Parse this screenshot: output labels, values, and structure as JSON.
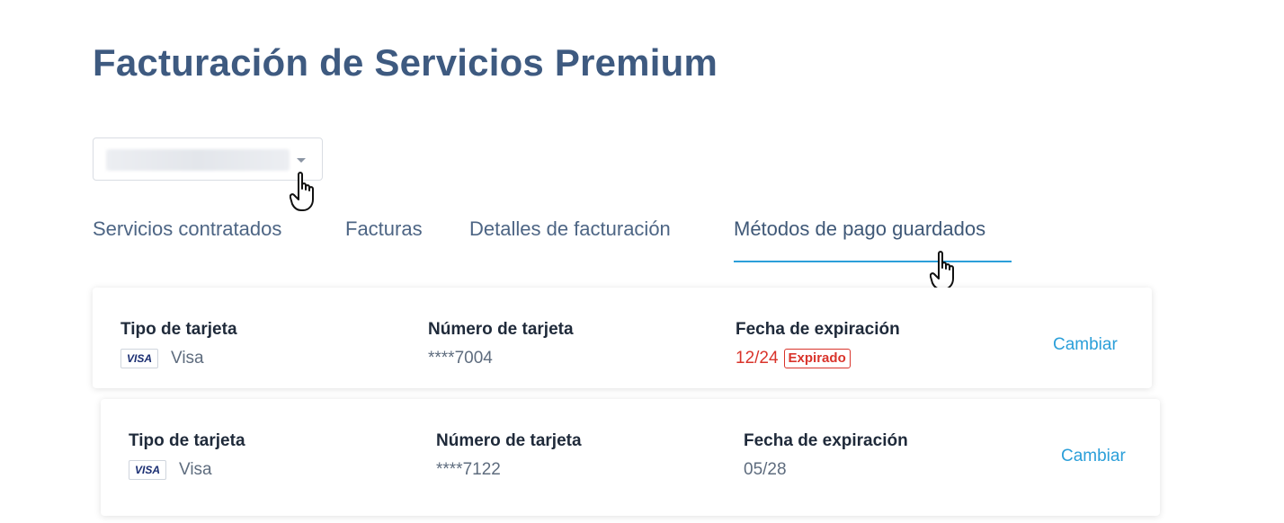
{
  "page": {
    "title": "Facturación de Servicios Premium"
  },
  "account_select": {
    "value": ""
  },
  "tabs": [
    {
      "label": "Servicios contratados",
      "active": false
    },
    {
      "label": "Facturas",
      "active": false
    },
    {
      "label": "Detalles de facturación",
      "active": false
    },
    {
      "label": "Métodos de pago guardados",
      "active": true
    }
  ],
  "payment_methods": [
    {
      "card_type_label": "Tipo de tarjeta",
      "card_brand_badge": "VISA",
      "card_brand": "Visa",
      "card_number_label": "Número de tarjeta",
      "card_number": "****7004",
      "expiry_label": "Fecha de expiración",
      "expiry": "12/24",
      "expired_badge": "Expirado",
      "change_label": "Cambiar"
    },
    {
      "card_type_label": "Tipo de tarjeta",
      "card_brand_badge": "VISA",
      "card_brand": "Visa",
      "card_number_label": "Número de tarjeta",
      "card_number": "****7122",
      "expiry_label": "Fecha de expiración",
      "expiry": "05/28",
      "change_label": "Cambiar"
    }
  ],
  "colors": {
    "title": "#3e5a80",
    "tab_text": "#4d6584",
    "tab_active_underline": "#2b9fd9",
    "link": "#2b9fd9",
    "expired": "#d9342b",
    "label": "#1f2a3a",
    "value": "#5e6c7e"
  },
  "icons": {
    "select_caret": "chevron-down-icon",
    "cursor": "hand-pointer-icon"
  }
}
